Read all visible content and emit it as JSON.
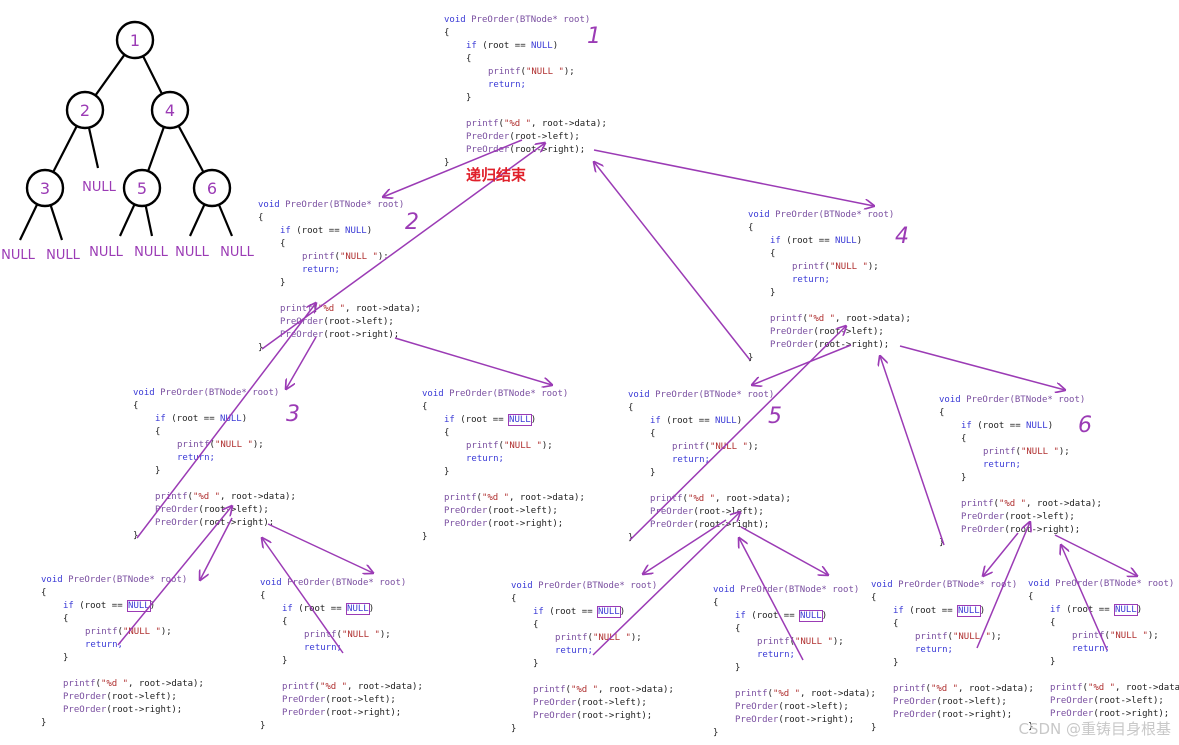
{
  "tree": {
    "nodes": [
      "1",
      "2",
      "4",
      "3",
      "5",
      "6"
    ],
    "null_label": "NULL",
    "edges": [
      [
        "1",
        "2"
      ],
      [
        "1",
        "4"
      ],
      [
        "2",
        "3"
      ],
      [
        "2",
        "NULL"
      ],
      [
        "4",
        "5"
      ],
      [
        "4",
        "6"
      ],
      [
        "3",
        "NULL"
      ],
      [
        "3",
        "NULL"
      ],
      [
        "5",
        "NULL"
      ],
      [
        "5",
        "NULL"
      ],
      [
        "6",
        "NULL"
      ],
      [
        "6",
        "NULL"
      ]
    ]
  },
  "code_lines": {
    "signature": "void PreOrder(BTNode* root)",
    "open": "{",
    "if_line": "if (root == NULL)",
    "printf_null": "printf(\"NULL \");",
    "return": "return;",
    "close": "}",
    "printf_data": "printf(\"%d \", root->data);",
    "left": "PreOrder(root->left);",
    "right": "PreOrder(root->right);",
    "null_kw": "NULL"
  },
  "call_numbers": [
    "1",
    "2",
    "4",
    "3",
    "5",
    "6"
  ],
  "recursion_end": "递归结束",
  "watermark": "CSDN @重铸目身根基"
}
